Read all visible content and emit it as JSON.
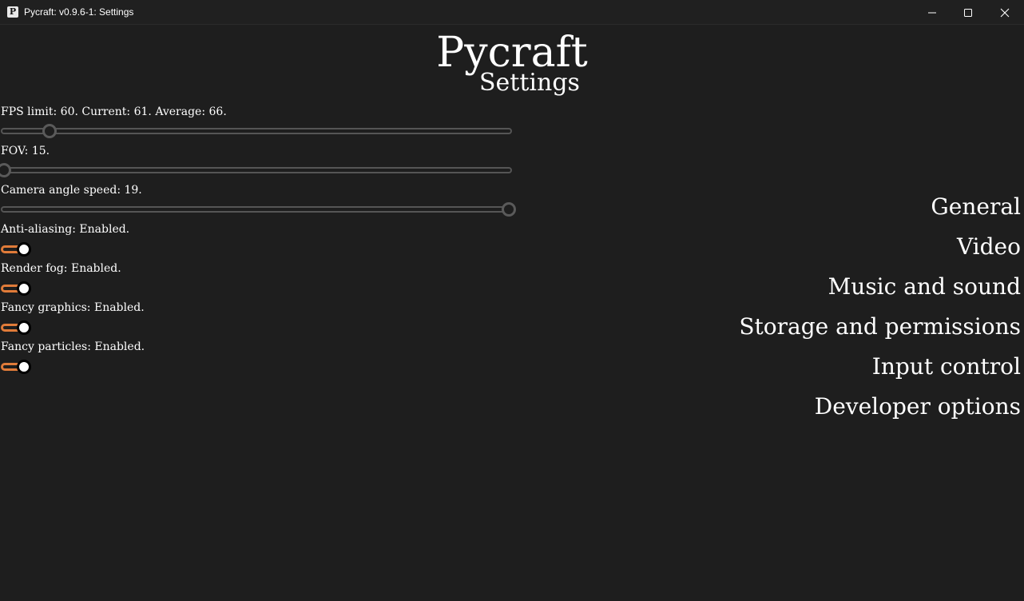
{
  "window": {
    "title": "Pycraft: v0.9.6-1: Settings",
    "icon_letter": "P",
    "icon": "app-icon",
    "controls": [
      "minimize-icon",
      "maximize-icon",
      "close-icon"
    ]
  },
  "header": {
    "title": "Pycraft",
    "subtitle": "Settings"
  },
  "settings": {
    "fps": {
      "label": "FPS limit: 60. Current: 61. Average: 66.",
      "slider_fraction": 0.09
    },
    "fov": {
      "label": "FOV: 15.",
      "slider_fraction": 0.0
    },
    "camera_speed": {
      "label": "Camera angle speed: 19.",
      "slider_fraction": 1.0
    },
    "anti_aliasing": {
      "label": "Anti-aliasing: Enabled.",
      "enabled": true
    },
    "render_fog": {
      "label": "Render fog: Enabled.",
      "enabled": true
    },
    "fancy_graphics": {
      "label": "Fancy graphics: Enabled.",
      "enabled": true
    },
    "fancy_particles": {
      "label": "Fancy particles: Enabled.",
      "enabled": true
    }
  },
  "nav": {
    "items": [
      {
        "label": "General"
      },
      {
        "label": "Video"
      },
      {
        "label": "Music and sound"
      },
      {
        "label": "Storage and permissions"
      },
      {
        "label": "Input control"
      },
      {
        "label": "Developer options"
      }
    ]
  },
  "colors": {
    "background": "#1e1e1e",
    "text": "#ffffff",
    "slider": "#555555",
    "toggle_accent": "#e07b39"
  }
}
